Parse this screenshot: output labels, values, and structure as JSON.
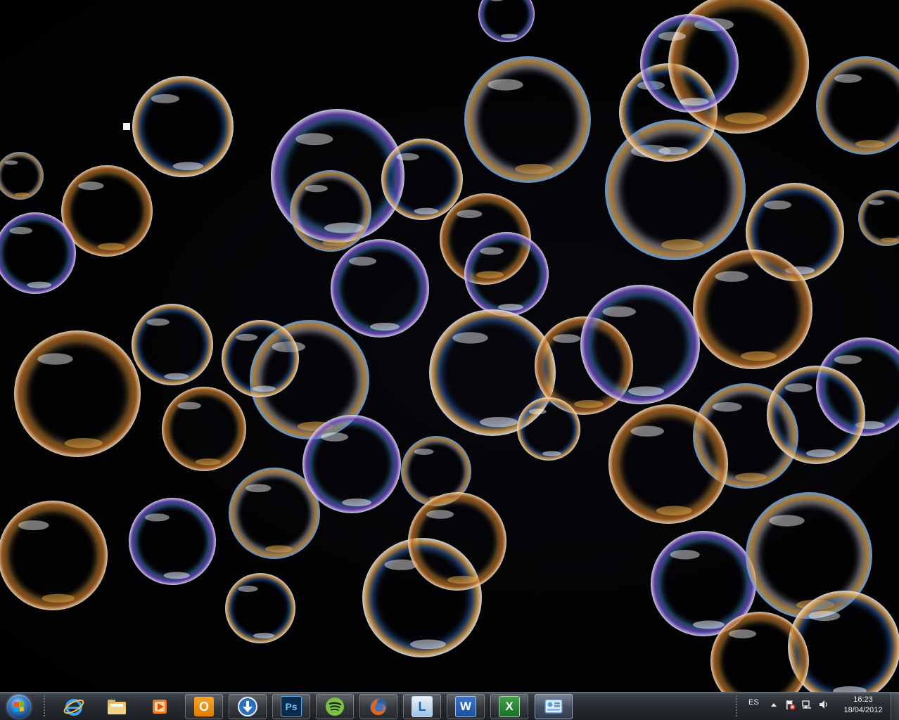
{
  "desktop": {
    "wallpaper": "soap-bubbles-on-black",
    "colors": {
      "background": "#020205",
      "bubble_gold": "#e0a040",
      "bubble_blue": "#3a7ee8",
      "bubble_white": "#e8e8f0"
    }
  },
  "taskbar": {
    "start": {
      "icon": "windows-orb-icon"
    },
    "pinned": [
      {
        "name": "internet-explorer",
        "icon": "internet-explorer-icon",
        "running": false
      },
      {
        "name": "windows-explorer",
        "icon": "folder-icon",
        "running": false
      },
      {
        "name": "media-player",
        "icon": "media-player-icon",
        "running": false
      },
      {
        "name": "outlook",
        "icon": "outlook-icon",
        "running": true,
        "letter": "O"
      },
      {
        "name": "download-manager",
        "icon": "download-icon",
        "running": true
      },
      {
        "name": "photoshop",
        "icon": "photoshop-icon",
        "running": true,
        "letter": "Ps"
      },
      {
        "name": "spotify",
        "icon": "spotify-icon",
        "running": true
      },
      {
        "name": "firefox",
        "icon": "firefox-icon",
        "running": true
      },
      {
        "name": "lync",
        "icon": "lync-icon",
        "running": true,
        "letter": "L"
      },
      {
        "name": "word",
        "icon": "word-icon",
        "running": true,
        "letter": "W"
      },
      {
        "name": "excel",
        "icon": "excel-icon",
        "running": true,
        "letter": "X"
      },
      {
        "name": "control-panel",
        "icon": "control-panel-icon",
        "running": true,
        "active": true
      }
    ],
    "tray": {
      "language": "ES",
      "icons": [
        "show-hidden-icons-icon",
        "flag-error-icon",
        "network-icon",
        "volume-icon"
      ],
      "time": "16:23",
      "date": "18/04/2012"
    }
  }
}
